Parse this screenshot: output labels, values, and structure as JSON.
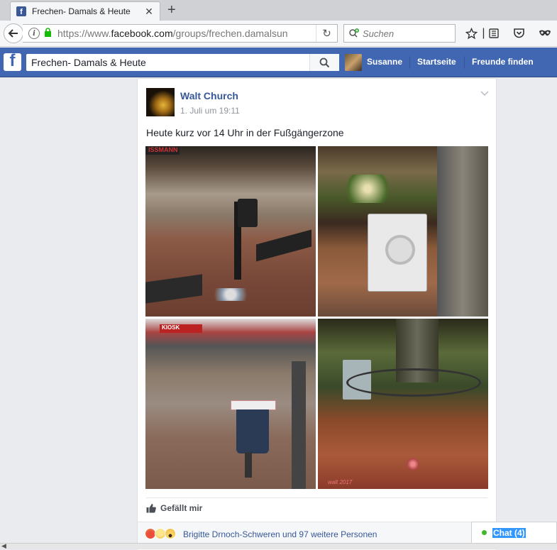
{
  "browser": {
    "tab_title": "Frechen- Damals & Heute",
    "url_prefix": "https://www.",
    "url_domain": "facebook.com",
    "url_path": "/groups/frechen.damalsun",
    "search_placeholder": "Suchen"
  },
  "fb": {
    "logo_letter": "f",
    "search_value": "Frechen- Damals & Heute",
    "user_name": "Susanne",
    "nav_home": "Startseite",
    "nav_find_friends": "Freunde finden"
  },
  "post": {
    "author": "Walt Church",
    "time": "1. Juli um 19:11",
    "text": "Heute kurz vor 14 Uhr in der Fußgängerzone",
    "photos": [
      "street-bin-bench",
      "washing-machine-tree",
      "kiosk-overflowing-bin",
      "tree-bin-litter"
    ],
    "photo_marks": {
      "p1_sign": "ISSMANN",
      "p3_sign": "KIOSK",
      "p4_mark": "walt 2017"
    },
    "like_label": "Gefällt mir",
    "reactions_text": "Brigitte Drnoch-Schweren und 97 weitere Personen",
    "reaction_icons": [
      "angry-emoji",
      "sad-emoji",
      "wow-emoji"
    ]
  },
  "chat": {
    "label": "Chat (4)"
  },
  "colors": {
    "fb_blue": "#4267b2",
    "link_blue": "#365899",
    "chat_online": "#42b72a"
  }
}
